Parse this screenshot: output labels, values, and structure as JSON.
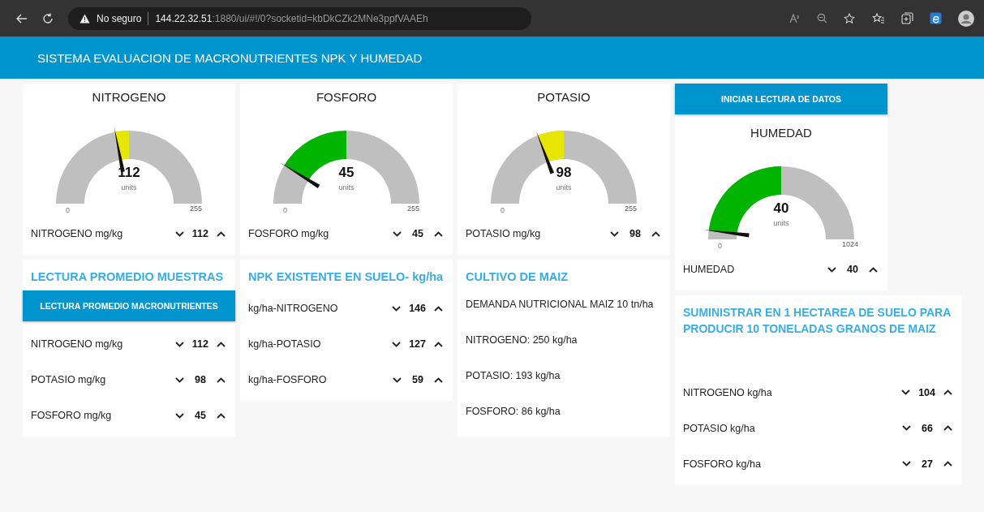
{
  "browser": {
    "security": "No seguro",
    "host": "144.22.32.51",
    "path": ":1880/ui/#!/0?socketid=kbDkCZk2MNe3ppfVAAEh"
  },
  "header": {
    "title": "SISTEMA EVALUACION DE MACRONUTRIENTES NPK Y HUMEDAD"
  },
  "columns": [
    {
      "cards": [
        {
          "items": [
            {
              "kind": "gauge",
              "title": "NITROGENO",
              "value": "112",
              "units": "units",
              "min": "0",
              "max": "255",
              "color": "#e6e600"
            },
            {
              "kind": "numeric",
              "label": "NITROGENO mg/kg",
              "value": "112"
            }
          ]
        },
        {
          "title": "LECTURA PROMEDIO MUESTRAS",
          "items": [
            {
              "kind": "button",
              "label": "LECTURA PROMEDIO MACRONUTRIENTES"
            },
            {
              "kind": "numeric",
              "label": "NITROGENO mg/kg",
              "value": "112"
            },
            {
              "kind": "numeric",
              "label": "POTASIO mg/kg",
              "value": "98"
            },
            {
              "kind": "numeric",
              "label": "FOSFORO mg/kg",
              "value": "45"
            }
          ]
        }
      ]
    },
    {
      "cards": [
        {
          "items": [
            {
              "kind": "gauge",
              "title": "FOSFORO",
              "value": "45",
              "units": "units",
              "min": "0",
              "max": "255",
              "color": "#00b400"
            },
            {
              "kind": "numeric",
              "label": "FOSFORO mg/kg",
              "value": "45"
            }
          ]
        },
        {
          "title": "NPK EXISTENTE EN SUELO- kg/ha",
          "items": [
            {
              "kind": "numeric",
              "label": "kg/ha-NITROGENO",
              "value": "146"
            },
            {
              "kind": "numeric",
              "label": "kg/ha-POTASIO",
              "value": "127"
            },
            {
              "kind": "numeric",
              "label": "kg/ha-FOSFORO",
              "value": "59"
            }
          ]
        }
      ]
    },
    {
      "cards": [
        {
          "items": [
            {
              "kind": "gauge",
              "title": "POTASIO",
              "value": "98",
              "units": "units",
              "min": "0",
              "max": "255",
              "color": "#e6e600"
            },
            {
              "kind": "numeric",
              "label": "POTASIO mg/kg",
              "value": "98"
            }
          ]
        },
        {
          "title": "CULTIVO DE MAIZ",
          "items": [
            {
              "kind": "text",
              "text": "DEMANDA NUTRICIONAL MAIZ 10 tn/ha"
            },
            {
              "kind": "text",
              "text": "NITROGENO: 250 kg/ha"
            },
            {
              "kind": "text",
              "text": "POTASIO: 193 kg/ha"
            },
            {
              "kind": "text",
              "text": "FOSFORO: 86 kg/ha"
            }
          ]
        }
      ]
    },
    {
      "cards": [
        {
          "items": [
            {
              "kind": "button",
              "label": "INICIAR LECTURA DE DATOS"
            },
            {
              "kind": "gauge",
              "title": "HUMEDAD",
              "value": "40",
              "units": "units",
              "min": "0",
              "max": "1024",
              "color": "#00b400"
            },
            {
              "kind": "numeric",
              "label": "HUMEDAD",
              "value": "40"
            }
          ]
        },
        {
          "title": "SUMINISTRAR EN 1 HECTAREA DE SUELO PARA PRODUCIR 10 TONELADAS GRANOS DE MAIZ",
          "items": [
            {
              "kind": "numeric",
              "label": "NITROGENO kg/ha",
              "value": "104"
            },
            {
              "kind": "numeric",
              "label": "POTASIO kg/ha",
              "value": "66"
            },
            {
              "kind": "numeric",
              "label": "FOSFORO kg/ha",
              "value": "27"
            }
          ]
        }
      ]
    }
  ]
}
